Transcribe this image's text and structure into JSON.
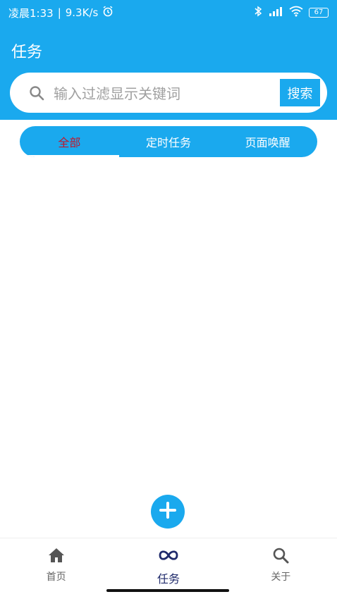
{
  "status_bar": {
    "time": "凌晨1:33",
    "speed": "9.3K/s",
    "battery": "67"
  },
  "header": {
    "title": "任务"
  },
  "search": {
    "placeholder": "输入过滤显示关键词",
    "button_label": "搜索"
  },
  "tabs": [
    {
      "label": "全部",
      "active": true
    },
    {
      "label": "定时任务",
      "active": false
    },
    {
      "label": "页面唤醒",
      "active": false
    }
  ],
  "fab": {
    "icon": "plus-icon"
  },
  "bottom_nav": {
    "items": [
      {
        "label": "首页",
        "icon": "home-icon",
        "active": false
      },
      {
        "label": "任务",
        "icon": "infinity-icon",
        "active": true
      },
      {
        "label": "关于",
        "icon": "search-icon",
        "active": false
      }
    ]
  },
  "colors": {
    "primary": "#1aa9ee",
    "active_tab_text": "#c0182c",
    "active_nav": "#1f2a6b",
    "inactive_nav": "#666666"
  }
}
